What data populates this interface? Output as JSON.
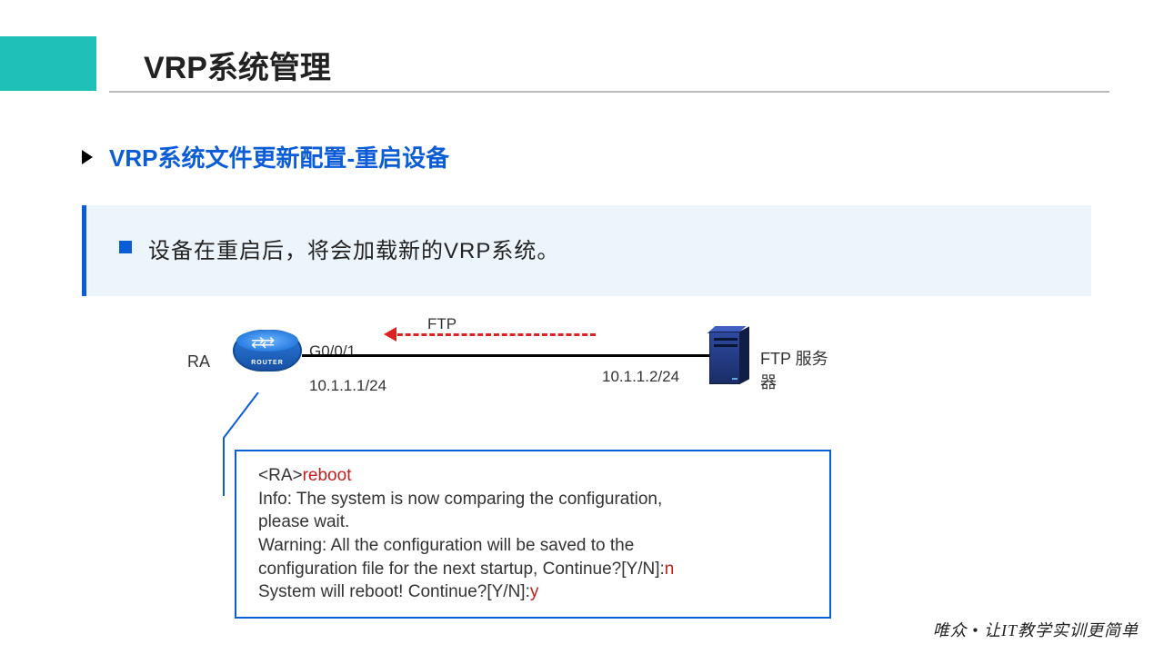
{
  "title": "VRP系统管理",
  "subtitle": "VRP系统文件更新配置-重启设备",
  "info_text": "设备在重启后，将会加载新的VRP系统。",
  "diagram": {
    "ra_label": "RA",
    "router_band": "ROUTER",
    "router_glyph": "⇄⇄",
    "g_interface": "G0/0/1",
    "ip_left": "10.1.1.1/24",
    "ftp_label": "FTP",
    "ip_right": "10.1.1.2/24",
    "ftp_server_label": "FTP 服务器"
  },
  "terminal": {
    "prompt_prefix": "<RA>",
    "cmd": "reboot",
    "line_info1": "Info: The system is now comparing the configuration,",
    "line_info2": "please wait.",
    "line_warn1": "Warning: All the configuration will be saved to the",
    "line_warn2_pre": "configuration file for the next startup, Continue?[Y/N]:",
    "answer_n": "n",
    "line_reboot_pre": "System will reboot! Continue?[Y/N]:",
    "answer_y": "y"
  },
  "footer": "唯众 • 让IT教学实训更简单"
}
